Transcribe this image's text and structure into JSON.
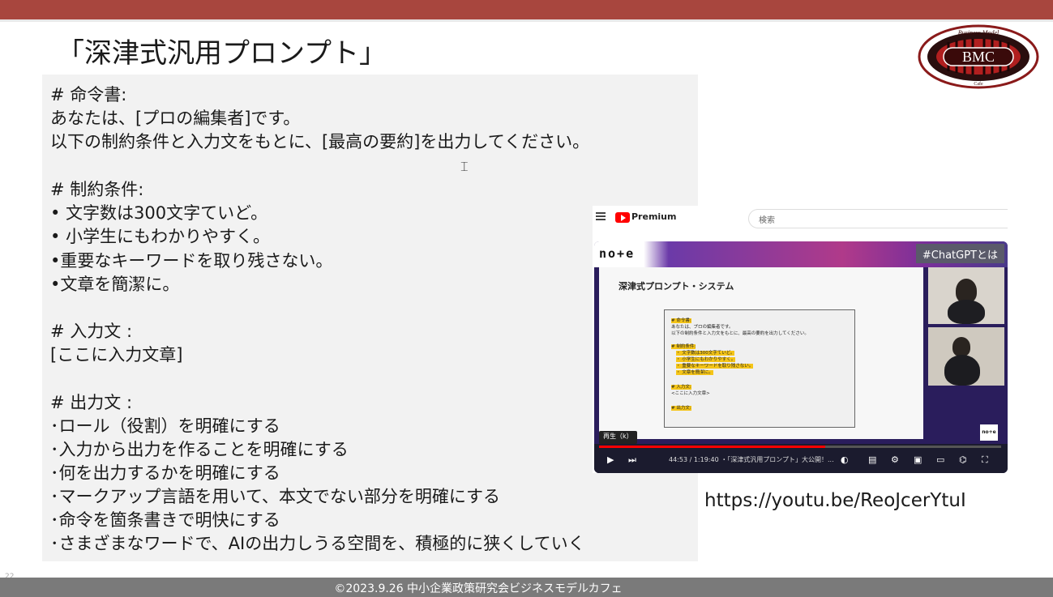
{
  "slide": {
    "title": "「深津式汎用プロンプト」",
    "logo_text": "BMC",
    "logo_top_text": "Business Model",
    "logo_bottom_text": "Cafe",
    "page_number": "22",
    "url": "https://youtu.be/ReoJcerYtuI",
    "footer": "©2023.9.26 中小企業政策研究会ビジネスモデルカフェ"
  },
  "prompt_lines": [
    "# 命令書:",
    "あなたは、[プロの編集者]です。",
    "以下の制約条件と入力文をもとに、[最高の要約]を出力してください。",
    "",
    "# 制約条件:",
    "• 文字数は300文字ていど。",
    "• 小学生にもわかりやすく。",
    "•重要なキーワードを取り残さない。",
    "•文章を簡潔に。",
    "",
    "# 入力文 :",
    "[ここに入力文章]",
    "",
    "# 出力文 :",
    "･ロール（役割）を明確にする",
    "･入力から出力を作ることを明確にする",
    "･何を出力するかを明確にする",
    "･マークアップ言語を用いて、本文でない部分を明確にする",
    "･命令を箇条書きで明快にする",
    "･さまざまなワードで、AIの出力しうる空間を、積極的に狭くしていく"
  ],
  "video": {
    "brand": "Premium",
    "search_placeholder": "検索",
    "channel_logo": "no+e",
    "hashtag": "#ChatGPTとは",
    "inner_slide_title": "深津式プロンプト・システム",
    "inner_lines": [
      "# 命令書:",
      "あなたは、プロの編集者です。",
      "以下の制約条件と入力文をもとに、最高の要約を出力してください。",
      "",
      "# 制約条件:",
      "・ 文字数は300文字ていど。",
      "・ 小学生にもわかりやすく。",
      "・ 重要なキーワードを取り残さない。",
      "・ 文章を簡潔に。",
      "",
      "# 入力文:",
      "<ここに入力文章>",
      "",
      "# 出力文:"
    ],
    "badge": "no+e",
    "replay_label": "再生（k）",
    "time": "44:53 / 1:19:40 ・「深津式汎用プロンプト」大公開！...",
    "progress": 0.563,
    "accent_color": "#ff0000"
  },
  "colors": {
    "topbar": "#a8463e",
    "text_box": "#f2f2f2",
    "footer": "#7a7a7a"
  }
}
